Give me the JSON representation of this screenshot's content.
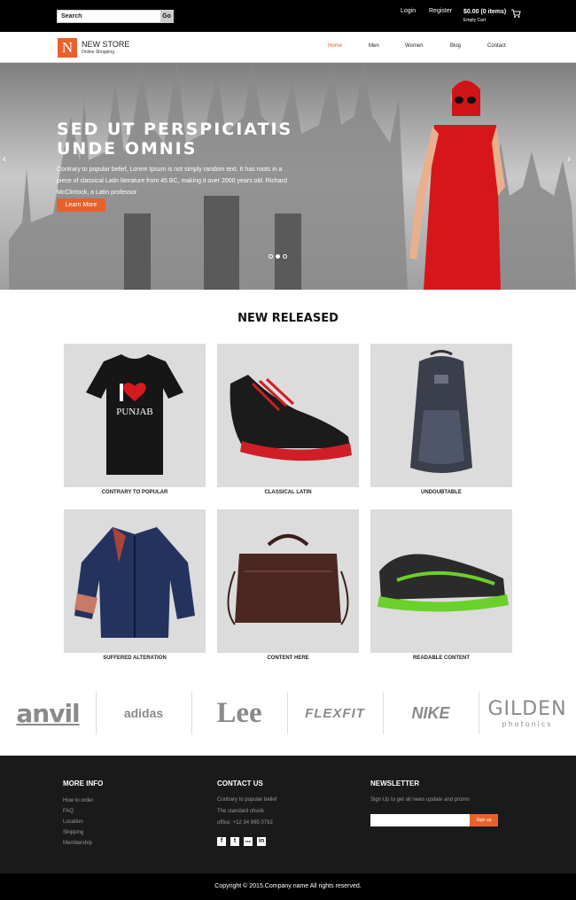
{
  "topbar": {
    "search_value": "Search",
    "search_button": "Go",
    "login": "Login",
    "register": "Register",
    "cart_total": "$0.00 (0 items)",
    "cart_label": "Empty Cart"
  },
  "header": {
    "logo_letter": "N",
    "logo_title": "NEW STORE",
    "logo_subtitle": "Online Shopping",
    "nav": [
      "Home",
      "Men",
      "Women",
      "Blog",
      "Contact"
    ],
    "active_nav": "Home"
  },
  "hero": {
    "title": "SED UT PERSPICIATIS UNDE OMNIS",
    "text": "Contrary to popular belief, Lorem Ipsum is not simply random text. It has roots in a piece of classical Latin literature from 45 BC, making it over 2000 years old. Richard McClintock, a Latin professor",
    "button": "Learn More",
    "prev_arrow": "‹",
    "next_arrow": "›"
  },
  "new_released": {
    "title": "NEW RELEASED",
    "tshirt_print": "PUNJAB",
    "products": [
      "CONTRARY TO POPULAR",
      "CLASSICAL LATIN",
      "UNDOUBTABLE",
      "SUFFERED ALTERATION",
      "CONTENT HERE",
      "READABLE CONTENT"
    ]
  },
  "brands": [
    "anvil",
    "adidas",
    "Lee",
    "FLEXFIT",
    "NIKE",
    "GILDEN",
    "photonics"
  ],
  "footer": {
    "more_info_title": "MORE INFO",
    "more_info_links": [
      "How to order",
      "FAQ",
      "Location",
      "Shipping",
      "Membership"
    ],
    "contact_title": "CONTACT US",
    "contact_lines": [
      "Contrary to popular belief",
      "The standard chunk",
      "office: +12 34 995 0792"
    ],
    "social": [
      "f",
      "t",
      "rss",
      "in"
    ],
    "newsletter_title": "NEWSLETTER",
    "newsletter_text": "Sign Up to get all news update and promo",
    "newsletter_button": "Sign up",
    "copyright": "Copyright © 2015.Company name All rights reserved."
  },
  "colors": {
    "accent": "#e8612c",
    "topbar": "#000000",
    "footer": "#1a1a1a"
  }
}
